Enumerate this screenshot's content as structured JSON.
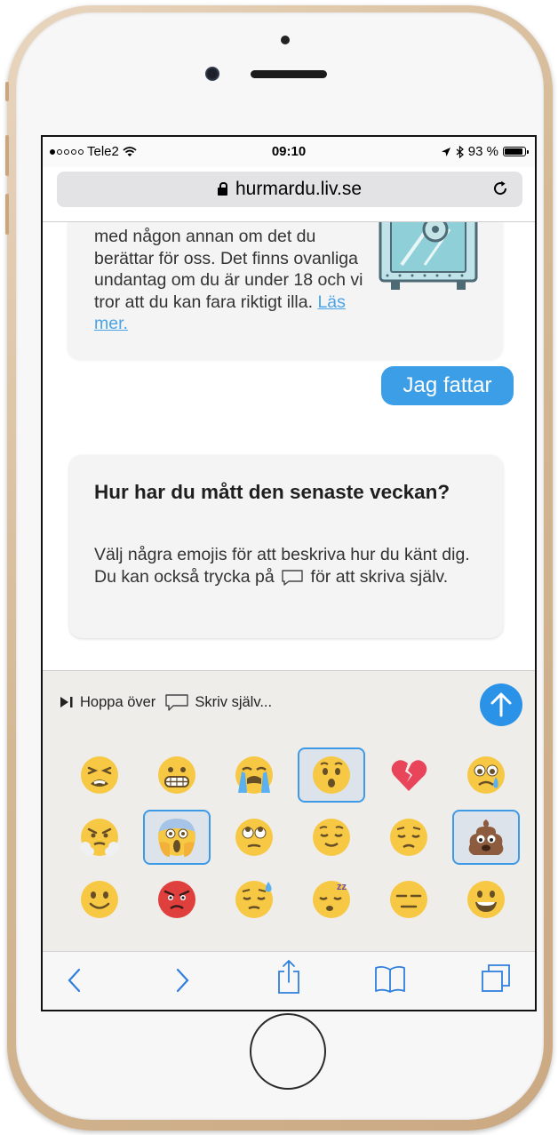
{
  "status": {
    "carrier": "Tele2",
    "time": "09:10",
    "battery": "93 %",
    "battery_level": 0.93,
    "signal_bars_on": 1,
    "signal_bars_total": 5
  },
  "browser": {
    "url": "hurmardu.liv.se"
  },
  "chat": {
    "info_text": "med någon annan om det du berättar för oss. Det finns ovanliga undantag om du är under 18 och vi tror att du kan fara riktigt illa.",
    "info_link": "Läs mer.",
    "reply": "Jag fattar",
    "question_title": "Hur har du mått den senaste veckan?",
    "question_body_part1": "Välj några emojis för att beskriva hur du känt dig. Du kan också trycka på",
    "question_body_part2": "för att skriva själv."
  },
  "input": {
    "skip_label": "Hoppa över",
    "write_label": "Skriv själv...",
    "emojis": [
      {
        "name": "tired-face",
        "selected": false
      },
      {
        "name": "grimacing-face",
        "selected": false
      },
      {
        "name": "loudly-crying-face",
        "selected": false
      },
      {
        "name": "hushed-face",
        "selected": true
      },
      {
        "name": "broken-heart",
        "selected": false
      },
      {
        "name": "crying-face",
        "selected": false
      },
      {
        "name": "face-with-steam",
        "selected": false
      },
      {
        "name": "face-screaming-in-fear",
        "selected": true
      },
      {
        "name": "face-with-rolling-eyes",
        "selected": false
      },
      {
        "name": "relieved-face",
        "selected": false
      },
      {
        "name": "pensive-face",
        "selected": false
      },
      {
        "name": "pile-of-poo",
        "selected": true
      },
      {
        "name": "slightly-smiling-face",
        "selected": false
      },
      {
        "name": "angry-face",
        "selected": false
      },
      {
        "name": "downcast-face-with-sweat",
        "selected": false
      },
      {
        "name": "sleeping-face",
        "selected": false
      },
      {
        "name": "expressionless-face",
        "selected": false
      },
      {
        "name": "grinning-face",
        "selected": false
      }
    ]
  },
  "colors": {
    "accent": "#3d9ee8",
    "send_button": "#2a93e8",
    "selected_border": "#3f9ae6",
    "emoji_yellow": "#f7c844",
    "phone_gold": "#d4b894"
  }
}
